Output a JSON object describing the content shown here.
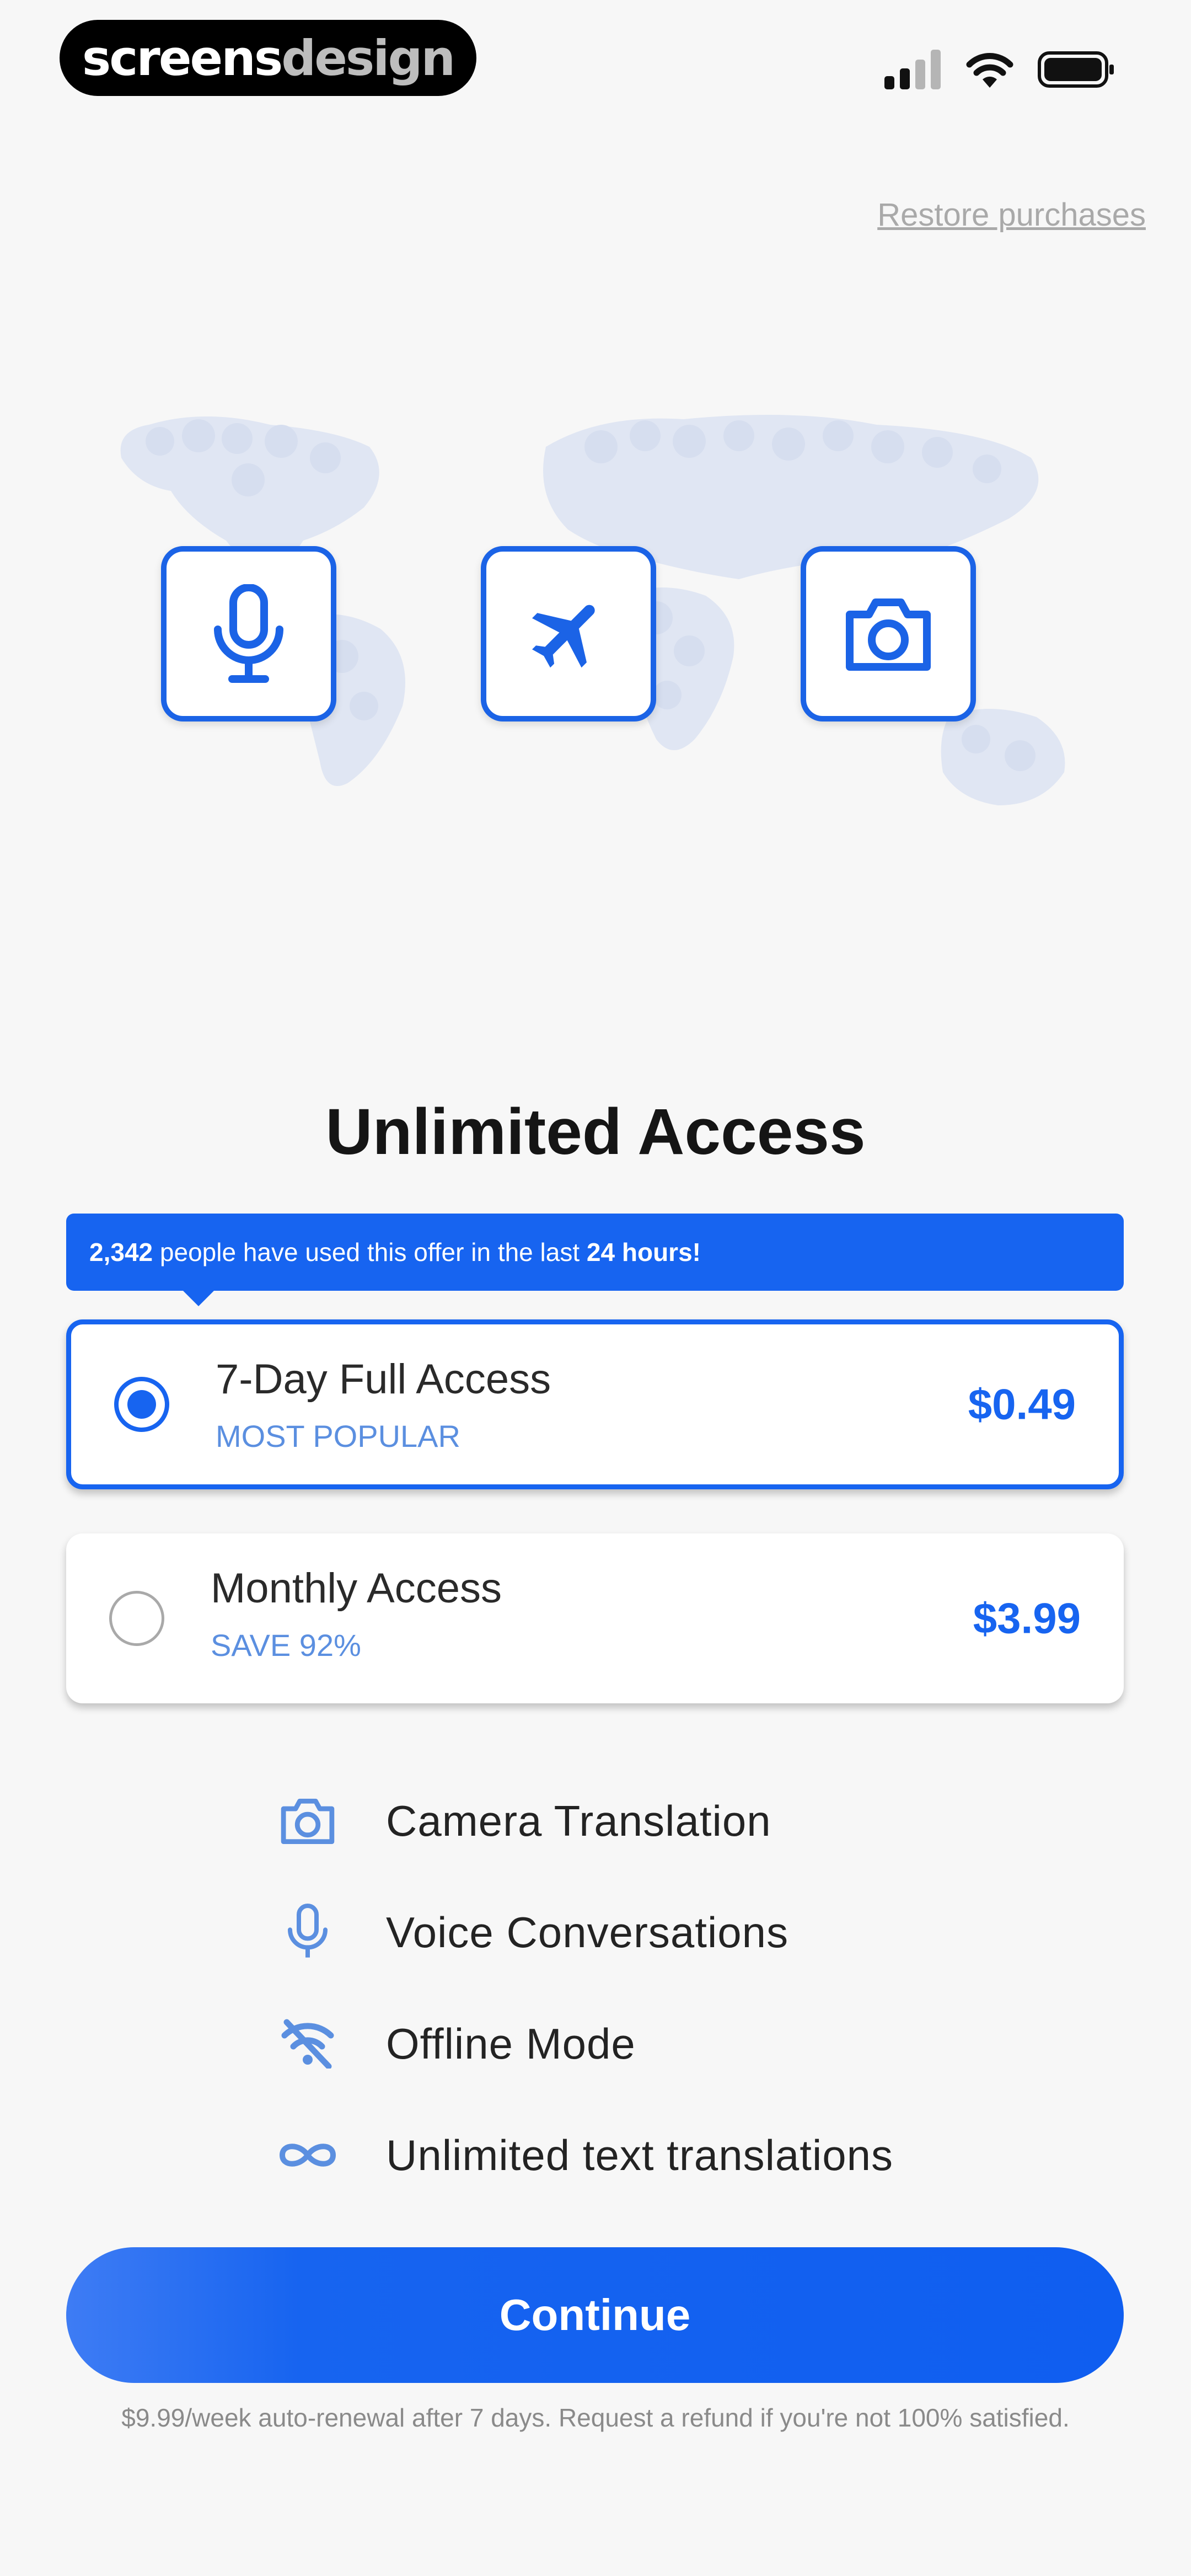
{
  "brand": {
    "part1": "screens",
    "part2": "design"
  },
  "header": {
    "restore_label": "Restore purchases"
  },
  "hero": {
    "tiles": [
      "mic-icon",
      "airplane-icon",
      "camera-icon"
    ]
  },
  "title": "Unlimited Access",
  "banner": {
    "count": "2,342",
    "middle": "people have used this offer in the last",
    "window": "24 hours!"
  },
  "plans": [
    {
      "name": "7-Day Full Access",
      "tag": "MOST POPULAR",
      "price": "$0.49",
      "selected": true
    },
    {
      "name": "Monthly Access",
      "tag": "SAVE 92%",
      "price": "$3.99",
      "selected": false
    }
  ],
  "features": [
    {
      "icon": "camera-icon",
      "label": "Camera Translation"
    },
    {
      "icon": "mic-icon",
      "label": "Voice Conversations"
    },
    {
      "icon": "wifi-off-icon",
      "label": "Offline Mode"
    },
    {
      "icon": "infinity-icon",
      "label": "Unlimited text translations"
    }
  ],
  "cta": {
    "label": "Continue"
  },
  "footer": {
    "fine_print": "$9.99/week auto-renewal after 7 days. Request a refund if you're not 100% satisfied."
  },
  "colors": {
    "accent": "#1764f0",
    "secondary": "#5b8fe0",
    "background": "#f7f7f7"
  }
}
